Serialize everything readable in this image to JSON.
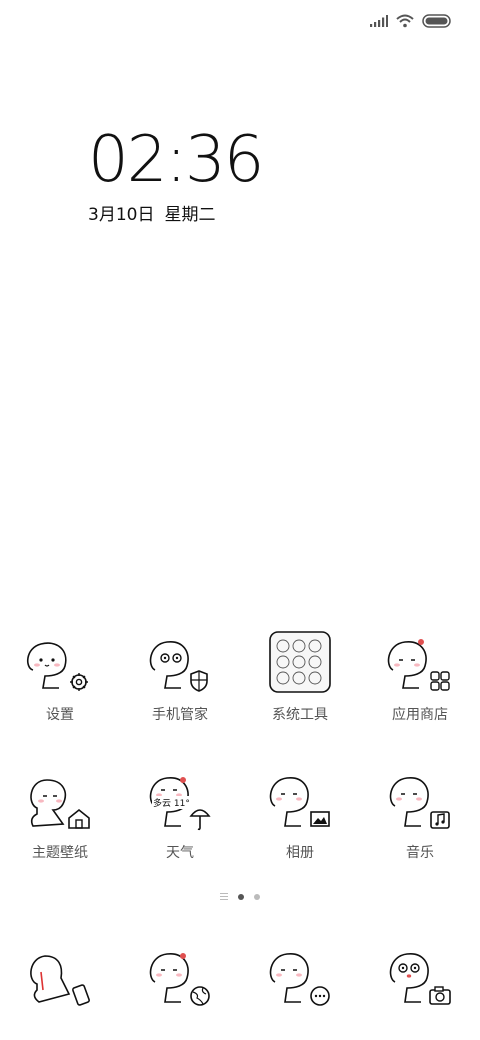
{
  "status_bar": {
    "signal_icon": "signal-icon",
    "wifi_icon": "wifi-icon",
    "battery_icon": "battery-icon"
  },
  "clock": {
    "time": "02:36",
    "date": "3月10日",
    "weekday": "星期二"
  },
  "apps_row1": [
    {
      "label": "设置",
      "icon": "settings-icon"
    },
    {
      "label": "手机管家",
      "icon": "security-icon"
    },
    {
      "label": "系统工具",
      "icon": "folder-icon"
    },
    {
      "label": "应用商店",
      "icon": "app-store-icon"
    }
  ],
  "apps_row2": [
    {
      "label": "主题壁纸",
      "icon": "theme-icon"
    },
    {
      "label": "天气",
      "icon": "weather-icon",
      "weather_text": "多云 11°"
    },
    {
      "label": "相册",
      "icon": "gallery-icon"
    },
    {
      "label": "音乐",
      "icon": "music-icon"
    }
  ],
  "dock": [
    {
      "icon": "phone-icon"
    },
    {
      "icon": "browser-icon"
    },
    {
      "icon": "messages-icon"
    },
    {
      "icon": "camera-icon"
    }
  ],
  "pager": {
    "pages": 2,
    "current": 1
  }
}
